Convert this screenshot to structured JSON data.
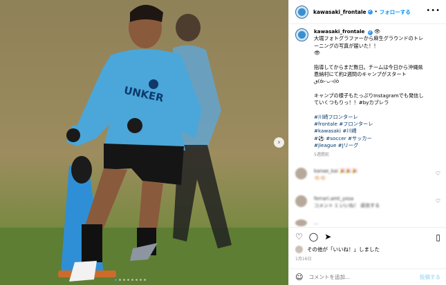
{
  "account": {
    "username": "kawasaki_frontale",
    "verified_mark": "✔",
    "follow_label": "フォローする",
    "separator": "•",
    "more_icon": "ellipsis-icon"
  },
  "photo": {
    "shirt_text": "UNKER",
    "description_icon": "training-photo"
  },
  "caption": {
    "username": "kawasaki_frontale",
    "lines": [
      "大堀フォトグラファーから麻生グラウンドのトレ",
      "ーニングの写真が届いた！！",
      "👁",
      "",
      "指導してからまだ数日。チームは今日から沖縄県",
      "恩納村にて約2週間のキャンプがスタート",
      "ٯ(ó▹·ᴗ·◃)ò",
      "",
      "キャンプの様子もたっぷりInstagramでも発信し",
      "ていくつもりっ！！#byカブレラ"
    ],
    "hashtags": [
      "#川崎フロンターレ",
      "#frontale #フロンターレ",
      "#kawasaki #川崎",
      "#⚽ #soccer #サッカー",
      "#jleague #Jリーグ"
    ],
    "time": "5週間前"
  },
  "comments": [
    {
      "name": "kanae_kai 🎉🎉🎉",
      "text": "👏🏻👏🏻"
    },
    {
      "name": "ferrari.amt_yxsa",
      "text": "コメント 1 いいね！ 返信する"
    },
    {
      "name": "...",
      "text": ""
    }
  ],
  "likes": {
    "text": "その他が「いいね！」しました"
  },
  "date": "1月16日",
  "add_comment": {
    "placeholder": "コメントを追加...",
    "post_label": "投稿する"
  },
  "colors": {
    "accent": "#0095f6",
    "shirt": "#4aa4d8",
    "grass": "#6f8a3a"
  }
}
